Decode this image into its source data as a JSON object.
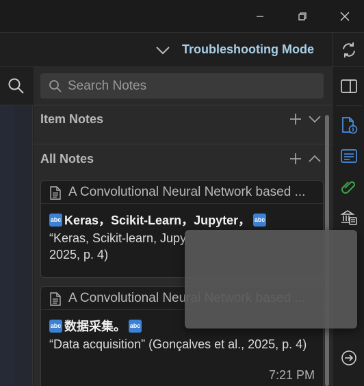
{
  "window_controls": {
    "minimize_icon": "minimize-icon",
    "restore_icon": "restore-icon",
    "close_icon": "close-icon"
  },
  "mode_bar": {
    "label": "Troubleshooting Mode",
    "accent_color": "#a9cfe8",
    "sync_icon": "sync-icon"
  },
  "search": {
    "placeholder": "Search Notes",
    "value": ""
  },
  "sections": {
    "item_notes": {
      "title": "Item Notes",
      "expanded": false
    },
    "all_notes": {
      "title": "All Notes",
      "expanded": true
    }
  },
  "notes": [
    {
      "title": "A Convolutional Neural Network based ...",
      "tags": [
        "Keras，Scikit-Learn，Jupyter，"
      ],
      "quote": "“Keras, Scikit-learn, Jupy",
      "quote_cont": "2025, p. 4)"
    },
    {
      "title": "A Convolutional Neural Network based ...",
      "tags": [
        "数据采集。"
      ],
      "quote": "“Data acquisition” (Gonçalves et al., 2025, p. 4)",
      "time": "7:21 PM"
    }
  ],
  "tag_icon_text": "abc",
  "right_sidebar": {
    "icons": [
      "toggle-pane-icon",
      "item-info-icon",
      "abstract-icon",
      "attachments-icon",
      "libraries-collections-icon",
      "locate-icon"
    ],
    "accent_color": "#4a8fe0"
  }
}
